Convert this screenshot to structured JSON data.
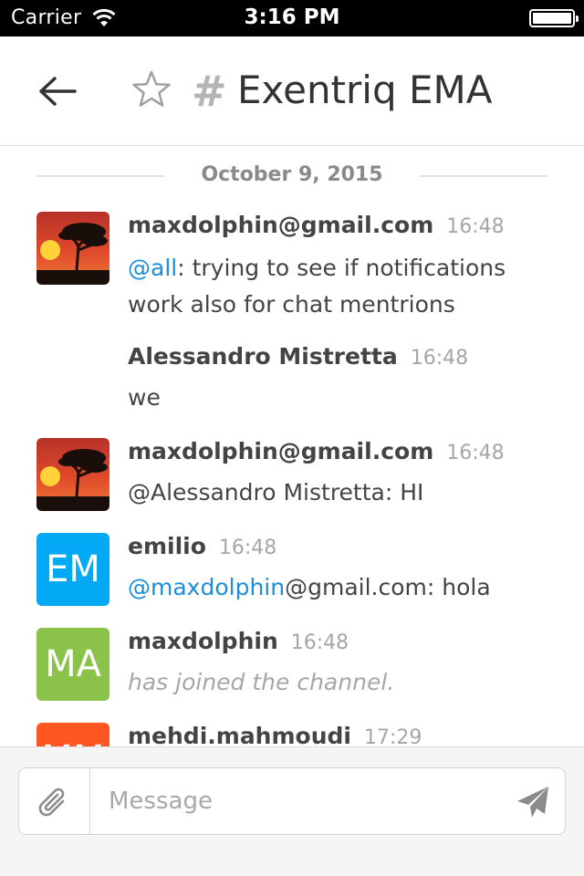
{
  "status_bar": {
    "carrier": "Carrier",
    "time": "3:16 PM",
    "battery_level": 1.0
  },
  "nav": {
    "channel_prefix": "#",
    "channel_name": "Exentriq EMA",
    "icons": [
      "back-arrow-icon",
      "star-icon",
      "hash-icon"
    ]
  },
  "date_divider": "October 9, 2015",
  "messages": [
    {
      "avatar": "sunset-photo",
      "user": "maxdolphin@gmail.com",
      "time": "16:48",
      "mention": "@all",
      "text": ": trying to see if notifications work also for chat mentrions"
    },
    {
      "user": "Alessandro Mistretta",
      "time": "16:48",
      "text": "we"
    },
    {
      "avatar": "sunset-photo",
      "user": "maxdolphin@gmail.com",
      "time": "16:48",
      "text": "@Alessandro Mistretta: HI"
    },
    {
      "avatar_initials": "EM",
      "avatar_color": "#03a9f4",
      "user": "emilio",
      "time": "16:48",
      "mention": "@maxdolphin",
      "text": "@gmail.com: hola"
    },
    {
      "avatar_initials": "MA",
      "avatar_color": "#8bc34a",
      "user": "maxdolphin",
      "time": "16:48",
      "text": "has joined the channel."
    },
    {
      "avatar_initials": "MM",
      "avatar_color": "#ff5722",
      "user": "mehdi.mahmoudi",
      "time": "17:29"
    }
  ],
  "composer": {
    "placeholder": "Message",
    "icons": [
      "paperclip-icon",
      "send-icon"
    ]
  },
  "colors": {
    "mention": "#1d8fd8",
    "status_bar": "#000000",
    "composer_bg": "#f5f5f5"
  }
}
